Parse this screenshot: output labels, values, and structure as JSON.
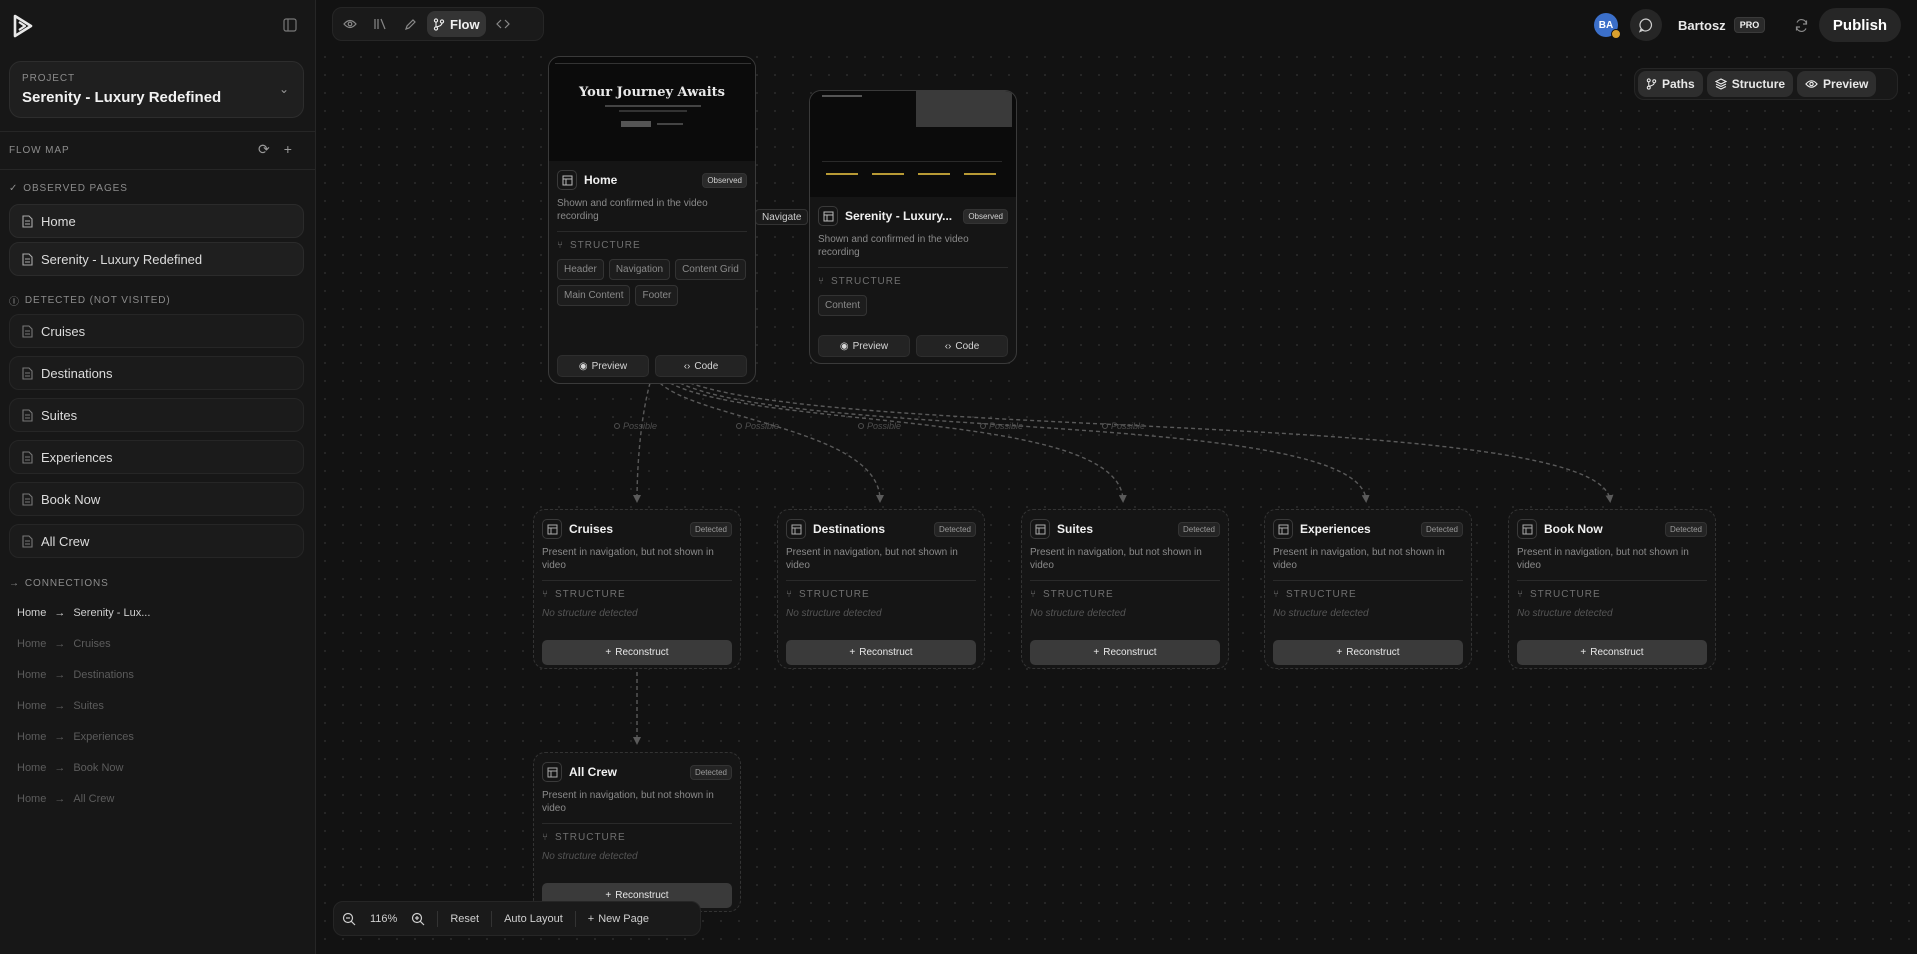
{
  "toolbar": {
    "flow_label": "Flow"
  },
  "user": {
    "initials": "BA",
    "name": "Bartosz",
    "plan": "PRO"
  },
  "header": {
    "publish_label": "Publish"
  },
  "view_switch": {
    "paths": "Paths",
    "structure": "Structure",
    "preview": "Preview"
  },
  "sidebar": {
    "project_label": "PROJECT",
    "project_name": "Serenity - Luxury Redefined",
    "flow_map_label": "FLOW MAP",
    "observed_label": "OBSERVED PAGES",
    "observed": [
      "Home",
      "Serenity - Luxury Redefined"
    ],
    "detected_label": "DETECTED (NOT VISITED)",
    "detected": [
      "Cruises",
      "Destinations",
      "Suites",
      "Experiences",
      "Book Now",
      "All Crew"
    ],
    "connections_label": "CONNECTIONS",
    "connections": [
      {
        "from": "Home",
        "to": "Serenity - Lux..."
      },
      {
        "from": "Home",
        "to": "Cruises"
      },
      {
        "from": "Home",
        "to": "Destinations"
      },
      {
        "from": "Home",
        "to": "Suites"
      },
      {
        "from": "Home",
        "to": "Experiences"
      },
      {
        "from": "Home",
        "to": "Book Now"
      },
      {
        "from": "Home",
        "to": "All Crew"
      }
    ]
  },
  "canvas": {
    "navigate_label": "Navigate",
    "possible_label": "Possible",
    "observed_cards": [
      {
        "title": "Home",
        "badge": "Observed",
        "desc": "Shown and confirmed in the video recording",
        "structure_label": "STRUCTURE",
        "chips": [
          "Header",
          "Navigation",
          "Content Grid",
          "Main Content",
          "Footer"
        ],
        "thumb_heading": "Your Journey Awaits",
        "preview": "Preview",
        "code": "Code"
      },
      {
        "title": "Serenity - Luxury...",
        "badge": "Observed",
        "desc": "Shown and confirmed in the video recording",
        "structure_label": "STRUCTURE",
        "chips": [
          "Content"
        ],
        "preview": "Preview",
        "code": "Code"
      }
    ],
    "detected_cards": [
      {
        "title": "Cruises",
        "badge": "Detected",
        "desc": "Present in navigation, but not shown in video",
        "structure_label": "STRUCTURE",
        "empty": "No structure detected",
        "action": "Reconstruct"
      },
      {
        "title": "Destinations",
        "badge": "Detected",
        "desc": "Present in navigation, but not shown in video",
        "structure_label": "STRUCTURE",
        "empty": "No structure detected",
        "action": "Reconstruct"
      },
      {
        "title": "Suites",
        "badge": "Detected",
        "desc": "Present in navigation, but not shown in video",
        "structure_label": "STRUCTURE",
        "empty": "No structure detected",
        "action": "Reconstruct"
      },
      {
        "title": "Experiences",
        "badge": "Detected",
        "desc": "Present in navigation, but not shown in video",
        "structure_label": "STRUCTURE",
        "empty": "No structure detected",
        "action": "Reconstruct"
      },
      {
        "title": "Book Now",
        "badge": "Detected",
        "desc": "Present in navigation, but not shown in video",
        "structure_label": "STRUCTURE",
        "empty": "No structure detected",
        "action": "Reconstruct"
      },
      {
        "title": "All Crew",
        "badge": "Detected",
        "desc": "Present in navigation, but not shown in video",
        "structure_label": "STRUCTURE",
        "empty": "No structure detected",
        "action": "Reconstruct"
      }
    ]
  },
  "zoom": {
    "level": "116%",
    "reset": "Reset",
    "auto_layout": "Auto Layout",
    "new_page": "New Page"
  }
}
